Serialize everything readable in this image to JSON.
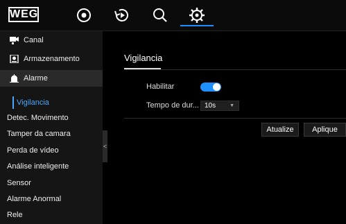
{
  "brand": {
    "logo_text": "WEG"
  },
  "top_nav": {
    "icons": [
      "live-view-icon",
      "playback-icon",
      "search-icon",
      "settings-icon"
    ],
    "active": "settings-icon",
    "accent": "#1e8fff"
  },
  "sidebar": {
    "items": [
      {
        "label": "Canal",
        "icon": "camera-icon"
      },
      {
        "label": "Armazenamento",
        "icon": "storage-icon"
      },
      {
        "label": "Alarme",
        "icon": "alarm-icon"
      }
    ],
    "subitems": [
      {
        "label": "Vigilancia"
      },
      {
        "label": "Detec. Movimento"
      },
      {
        "label": "Tamper da camara"
      },
      {
        "label": "Perda de vídeo"
      },
      {
        "label": "Análise inteligente"
      },
      {
        "label": "Sensor"
      },
      {
        "label": "Alarme Anormal"
      },
      {
        "label": "Rele"
      }
    ],
    "collapse_glyph": "<"
  },
  "main": {
    "title": "Vigilancia",
    "fields": {
      "enable_label": "Habilitar",
      "enable_on": true,
      "duration_label": "Tempo de dur...",
      "duration_value": "10s"
    },
    "buttons": {
      "refresh": "Atualize",
      "apply": "Aplique"
    }
  }
}
